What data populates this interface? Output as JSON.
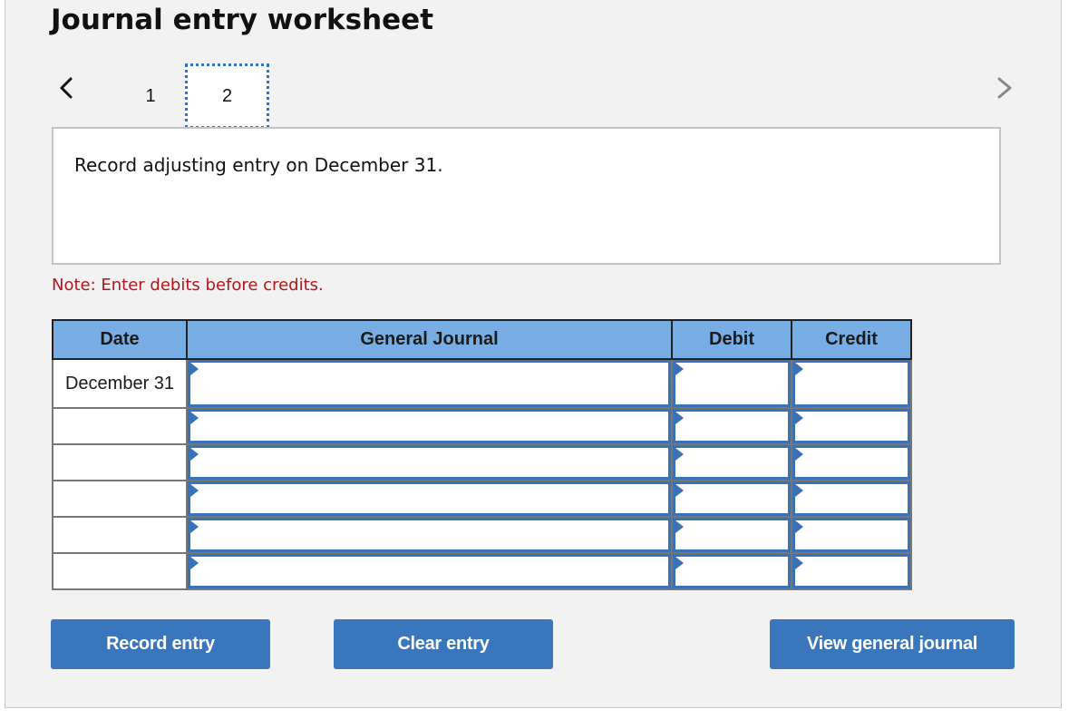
{
  "header": {
    "title": "Journal entry worksheet"
  },
  "navigation": {
    "prev_icon": "chevron-left-icon",
    "next_icon": "chevron-right-icon",
    "tabs": [
      {
        "label": "1",
        "active": false
      },
      {
        "label": "2",
        "active": true
      }
    ]
  },
  "prompt": {
    "text": "Record adjusting entry on December 31."
  },
  "note": {
    "text": "Note: Enter debits before credits."
  },
  "journal": {
    "columns": [
      "Date",
      "General Journal",
      "Debit",
      "Credit"
    ],
    "rows": [
      {
        "date": "December 31",
        "account": "",
        "debit": "",
        "credit": ""
      },
      {
        "date": "",
        "account": "",
        "debit": "",
        "credit": ""
      },
      {
        "date": "",
        "account": "",
        "debit": "",
        "credit": ""
      },
      {
        "date": "",
        "account": "",
        "debit": "",
        "credit": ""
      },
      {
        "date": "",
        "account": "",
        "debit": "",
        "credit": ""
      },
      {
        "date": "",
        "account": "",
        "debit": "",
        "credit": ""
      }
    ]
  },
  "buttons": {
    "record": "Record entry",
    "clear": "Clear entry",
    "view": "View general journal"
  },
  "colors": {
    "accent": "#3a76bb",
    "header_bg": "#78ade3",
    "note": "#b5131a"
  }
}
